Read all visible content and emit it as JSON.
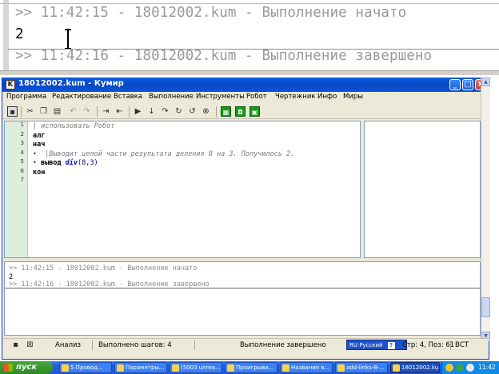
{
  "zoom": {
    "line1": ">> 11:42:15 - 18012002.kum - Выполнение начато",
    "value": "2",
    "line2": ">> 11:42:16 - 18012002.kum - Выполнение завершено"
  },
  "window": {
    "title": "18012002.kum - Кумир",
    "app_icon": "K",
    "controls": {
      "minimize": "_",
      "maximize": "□",
      "close": "×"
    }
  },
  "menu": [
    "Программа",
    "Редактирование",
    "Вставка",
    "Выполнение",
    "Инструменты",
    "Робот",
    "Чертежник",
    "Инфо",
    "Миры"
  ],
  "toolbar_icons": [
    "save-icon",
    "cut-icon",
    "copy-icon",
    "paste-icon",
    "undo-icon",
    "redo-icon",
    "indent-icon",
    "outdent-icon",
    "run-icon",
    "step-icon",
    "step-into-icon",
    "step-out-icon",
    "run-to-cursor-icon",
    "stop-icon",
    "grid-icon-1",
    "grid-icon-2",
    "grid-icon-3"
  ],
  "editor": {
    "line_numbers": [
      "1",
      "2",
      "3",
      "4",
      "5",
      "6",
      "7"
    ],
    "lines": {
      "l1": "| использовать Робот",
      "l2": "алг",
      "l3": "нач",
      "l4": "|Выводит целой части результата деления 8 на 3. Получилось 2.",
      "l5_kw": "вывод",
      "l5_fn": "div",
      "l5_args": "(8,3)",
      "l6": "кон"
    }
  },
  "console": {
    "line1": ">> 11:42:15 - 18012002.kum - Выполнение начато",
    "value": "2",
    "line2": ">> 11:42:16 - 18012002.kum - Выполнение завершено"
  },
  "status": {
    "mode": "Анализ",
    "steps": "Выполнено шагов: 4",
    "state": "Выполнение завершено",
    "language": "RU Русский",
    "help": "?",
    "position": "Стр: 4, Поз: 61",
    "insert_mode": "ВСТ"
  },
  "taskbar": {
    "start": "пуск",
    "tasks": [
      "5 Провод...",
      "Параметры...",
      "(5003 unrea...",
      "Проигрыва...",
      "Название в...",
      "add-links-8-...",
      "18012002.ku..."
    ],
    "clock": "11:42"
  }
}
